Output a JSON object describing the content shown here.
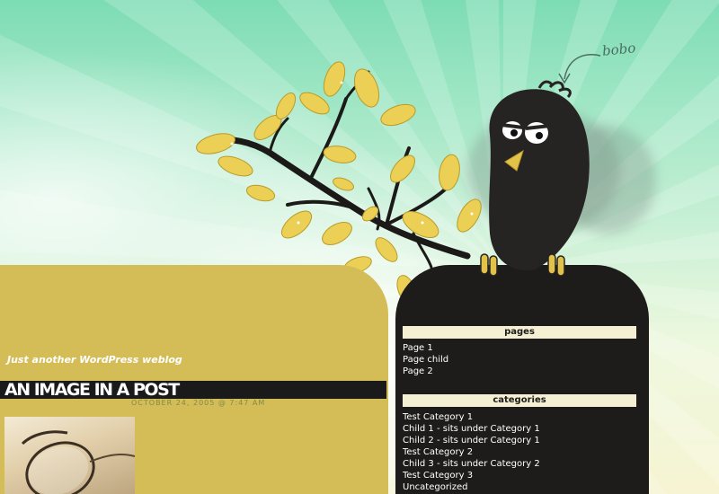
{
  "header": {
    "tagline": "Just another WordPress weblog",
    "signature": "bobo"
  },
  "post": {
    "title": "AN IMAGE IN A POST",
    "date": "OCTOBER 24, 2005 @ 7:47 AM"
  },
  "sidebar": {
    "pages": {
      "heading": "pages",
      "items": [
        "Page 1",
        "Page child",
        "Page 2"
      ]
    },
    "categories": {
      "heading": "categories",
      "items": [
        "Test Category 1",
        "Child 1 - sits under Category 1",
        "Child 2 - sits under Category 1",
        "Test Category 2",
        "Child 3 - sits under Category 2",
        "Test Category 3",
        "Uncategorized"
      ]
    }
  },
  "colors": {
    "content_panel": "#d4bd56",
    "sidebar_panel": "#1e1c1b",
    "widget_heading_bg": "#f5efd4",
    "leaf": "#eccf55",
    "bird": "#262422"
  },
  "icons": [
    "branch-with-leaves-icon",
    "crow-mascot-icon",
    "glasses-icon",
    "arrow-icon"
  ]
}
